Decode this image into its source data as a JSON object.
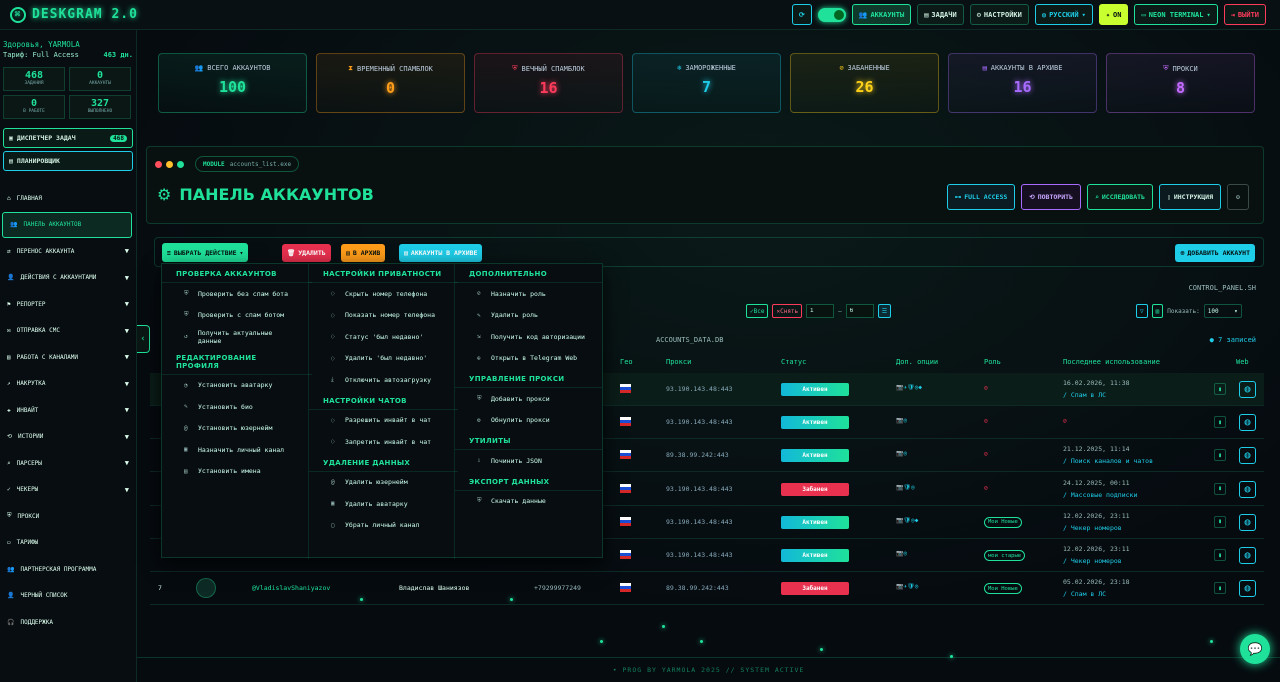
{
  "app": {
    "title": "DESKGRAM 2.0"
  },
  "topbar": {
    "refresh": "⟳",
    "accounts": "АККАУНТЫ",
    "tasks": "ЗАДАЧИ",
    "settings": "НАСТРОЙКИ",
    "language": "РУССКИЙ",
    "on": "ON",
    "theme": "NEON TERMINAL",
    "logout": "ВЫЙТИ"
  },
  "sidebar": {
    "greeting": "Здоровья, YARMOLA",
    "tariff_label": "Тариф: Full Access",
    "tariff_days": "463 дн.",
    "stats": [
      {
        "n": "468",
        "l": "ЗАДАНИЯ"
      },
      {
        "n": "0",
        "l": "АККАУНТЫ"
      },
      {
        "n": "0",
        "l": "В РАБОТЕ"
      },
      {
        "n": "327",
        "l": "ВЫПОЛНЕНО"
      }
    ],
    "dispatcher": "ДИСПЕТЧЕР ЗАДАЧ",
    "dispatcher_badge": "468",
    "planner": "ПЛАНИРОВЩИК",
    "nav": [
      "ГЛАВНАЯ",
      "ПАНЕЛЬ АККАУНТОВ",
      "ПЕРЕНОС АККАУНТА",
      "ДЕЙСТВИЯ С АККАУНТАМИ",
      "РЕПОРТЕР",
      "ОТПРАВКА СМС",
      "РАБОТА С КАНАЛАМИ",
      "НАКРУТКА",
      "ИНВАЙТ",
      "ИСТОРИИ",
      "ПАРСЕРЫ",
      "ЧЕКЕРЫ",
      "ПРОКСИ",
      "ТАРИФЫ",
      "ПАРТНЕРСКАЯ ПРОГРАММА",
      "ЧЕРНЫЙ СПИСОК",
      "ПОДДЕРЖКА"
    ]
  },
  "cards": [
    {
      "t": "ВСЕГО АККАУНТОВ",
      "v": "100",
      "c": "#1fe19a"
    },
    {
      "t": "ВРЕМЕННЫЙ СПАМБЛОК",
      "v": "0",
      "c": "#ff9d1a"
    },
    {
      "t": "ВЕЧНЫЙ СПАМБЛОК",
      "v": "16",
      "c": "#ff3b5c"
    },
    {
      "t": "ЗАМОРОЖЕННЫЕ",
      "v": "7",
      "c": "#1ecde8"
    },
    {
      "t": "ЗАБАНЕННЫЕ",
      "v": "26",
      "c": "#ffd21a"
    },
    {
      "t": "АККАУНТЫ В АРХИВЕ",
      "v": "16",
      "c": "#a86bff"
    },
    {
      "t": "ПРОКСИ",
      "v": "8",
      "c": "#c46bff"
    }
  ],
  "panel": {
    "module": "MODULE",
    "module_file": "accounts_list.exe",
    "title": "ПАНЕЛЬ АККАУНТОВ",
    "buttons": [
      "FULL ACCESS",
      "ПОВТОРИТЬ",
      "ИССЛЕДОВАТЬ",
      "ИНСТРУКЦИЯ"
    ]
  },
  "actions": {
    "select": "ВЫБРАТЬ ДЕЙСТВИЕ",
    "delete": "УДАЛИТЬ",
    "archive": "В АРХИВ",
    "archived": "АККАУНТЫ В АРХИВЕ",
    "add": "ДОБАВИТЬ АККАУНТ"
  },
  "table": {
    "control": "CONTROL_PANEL.SH",
    "all": "Все",
    "clear": "Снять",
    "from": "1",
    "to": "6",
    "show_label": "Показать:",
    "show_value": "100",
    "db": "ACCOUNTS_DATA.DB",
    "records": "7 записей",
    "headers": [
      "Гео",
      "Прокси",
      "Статус",
      "Доп. опции",
      "Роль",
      "Последнее использование",
      "Web"
    ],
    "rows": [
      {
        "proxy": "93.190.143.48:443",
        "status": "Активен",
        "opts": "📷✈🛡◎◆",
        "role": "",
        "date": "16.02.2026, 11:38",
        "note": "/ Спам в ЛС"
      },
      {
        "proxy": "93.190.143.48:443",
        "status": "Активен",
        "opts": "📷◎",
        "role": "",
        "date": "",
        "note": ""
      },
      {
        "proxy": "89.38.99.242:443",
        "status": "Активен",
        "opts": "📷◎",
        "role": "",
        "date": "21.12.2025, 11:14",
        "note": "/ Поиск каналов и чатов"
      },
      {
        "proxy": "93.190.143.48:443",
        "status": "Забанен",
        "opts": "📷🛡◎",
        "role": "",
        "date": "24.12.2025, 00:11",
        "note": "/ Массовые подписки"
      },
      {
        "proxy": "93.190.143.48:443",
        "status": "Активен",
        "opts": "📷🛡◎◆",
        "role": "Мои Новые",
        "date": "12.02.2026, 23:11",
        "note": "/ Чекер номеров"
      },
      {
        "proxy": "93.190.143.48:443",
        "status": "Активен",
        "opts": "📷◎",
        "role": "мои старые",
        "date": "12.02.2026, 23:11",
        "note": "/ Чекер номеров"
      },
      {
        "proxy": "89.38.99.242:443",
        "status": "Забанен",
        "opts": "📷✈🛡◎",
        "role": "Мои Новые",
        "date": "05.02.2026, 23:18",
        "note": "/ Спам в ЛС",
        "num": "7",
        "user": "@VladislavShaniyazov",
        "name": "Владислав Шаниязов",
        "phone": "+79299977249"
      }
    ]
  },
  "dropdown": {
    "c1": [
      {
        "h": "ПРОВЕРКА АККАУНТОВ",
        "items": [
          "Проверить без спам бота",
          "Проверить с спам ботом",
          "Получить актуальные данные"
        ]
      },
      {
        "h": "РЕДАКТИРОВАНИЕ ПРОФИЛЯ",
        "items": [
          "Установить аватарку",
          "Установить био",
          "Установить юзернейм",
          "Назначить личный канал",
          "Установить имена"
        ]
      }
    ],
    "c2": [
      {
        "h": "НАСТРОЙКИ ПРИВАТНОСТИ",
        "items": [
          "Скрыть номер телефона",
          "Показать номер телефона",
          "Статус 'был недавно'",
          "Удалить 'был недавно'",
          "Отключить автозагрузку"
        ]
      },
      {
        "h": "НАСТРОЙКИ ЧАТОВ",
        "items": [
          "Разрешить инвайт в чат",
          "Запретить инвайт в чат"
        ]
      },
      {
        "h": "УДАЛЕНИЕ ДАННЫХ",
        "items": [
          "Удалить юзернейм",
          "Удалить аватарку",
          "Убрать личный канал"
        ]
      }
    ],
    "c3": [
      {
        "h": "ДОПОЛНИТЕЛЬНО",
        "items": [
          "Назначить роль",
          "Удалить роль",
          "Получить код авторизации",
          "Открыть в Telegram Web"
        ]
      },
      {
        "h": "УПРАВЛЕНИЕ ПРОКСИ",
        "items": [
          "Добавить прокси",
          "Обнулить прокси"
        ]
      },
      {
        "h": "УТИЛИТЫ",
        "items": [
          "Починить JSON"
        ]
      },
      {
        "h": "ЭКСПОРТ ДАННЫХ",
        "items": [
          "Скачать данные"
        ]
      }
    ]
  },
  "footer": "• PROG BY YARMOLA 2025   // SYSTEM ACTIVE"
}
